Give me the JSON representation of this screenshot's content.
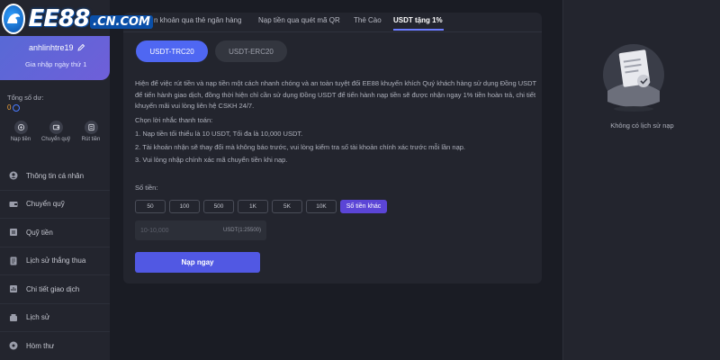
{
  "brand": {
    "name": "EE88",
    "domain": ".CN.COM"
  },
  "user": {
    "username": "anhlinhtre19",
    "join_text": "Gia nhập ngày thứ 1"
  },
  "balance": {
    "label": "Tổng số dư:",
    "value": "0"
  },
  "quick_actions": [
    {
      "label": "Nạp tiền",
      "icon": "wallet-icon"
    },
    {
      "label": "Chuyển quỹ",
      "icon": "transfer-icon"
    },
    {
      "label": "Rút tiền",
      "icon": "withdraw-icon"
    }
  ],
  "menu": [
    {
      "label": "Thông tin cá nhân",
      "icon": "user-icon"
    },
    {
      "label": "Chuyển quỹ",
      "icon": "transfer-icon"
    },
    {
      "label": "Quỹ tiền",
      "icon": "fund-icon"
    },
    {
      "label": "Lịch sử thắng thua",
      "icon": "document-icon"
    },
    {
      "label": "Chi tiết giao dịch",
      "icon": "chart-icon"
    },
    {
      "label": "Lịch sử",
      "icon": "history-icon"
    },
    {
      "label": "Hòm thư",
      "icon": "mail-icon"
    }
  ],
  "tabs": [
    {
      "label": "n khoản qua thẻ ngân hàng",
      "active": false
    },
    {
      "label": "Nạp tiền qua quét mã QR",
      "active": false
    },
    {
      "label": "Thẻ Cào",
      "active": false
    },
    {
      "label": "USDT tặng 1%",
      "active": true
    }
  ],
  "networks": [
    {
      "label": "USDT-TRC20",
      "active": true
    },
    {
      "label": "USDT-ERC20",
      "active": false
    }
  ],
  "intro": "Hiện để việc rút tiền và nạp tiền một cách nhanh chóng và an toàn tuyệt đối EE88 khuyến khích Quý khách hàng sử dụng Đồng USDT để tiến hành giao dịch, đồng thời hiện chỉ cần sử dụng Đồng USDT để tiến hành nạp tiền sẽ được nhận ngay 1% tiền hoàn trả, chi tiết khuyến mãi vui lòng liên hệ CSKH 24/7.",
  "choose_label": "Chọn lời nhắc thanh toán:",
  "notes": [
    "1. Nạp tiền tối thiểu là 10 USDT, Tối đa là 10,000 USDT.",
    "2. Tài khoản nhận sẽ thay đổi mà không báo trước, vui lòng kiểm tra số tài khoản chính xác trước mỗi lần nạp.",
    "3. Vui lòng nhập chính xác mã chuyển tiền khi nạp."
  ],
  "amount": {
    "label": "Số tiền:",
    "chips": [
      "50",
      "100",
      "500",
      "1K",
      "5K",
      "10K"
    ],
    "other_label": "Số tiền khác",
    "placeholder": "10-10,000",
    "unit": "USDT(1:25500)"
  },
  "submit_label": "Nạp ngay",
  "history": {
    "empty_text": "Không có lịch sử nạp"
  },
  "colors": {
    "accent": "#4f67f2",
    "sidebar": "#23252e",
    "background": "#1a1c24",
    "balance": "#f2a33a"
  }
}
